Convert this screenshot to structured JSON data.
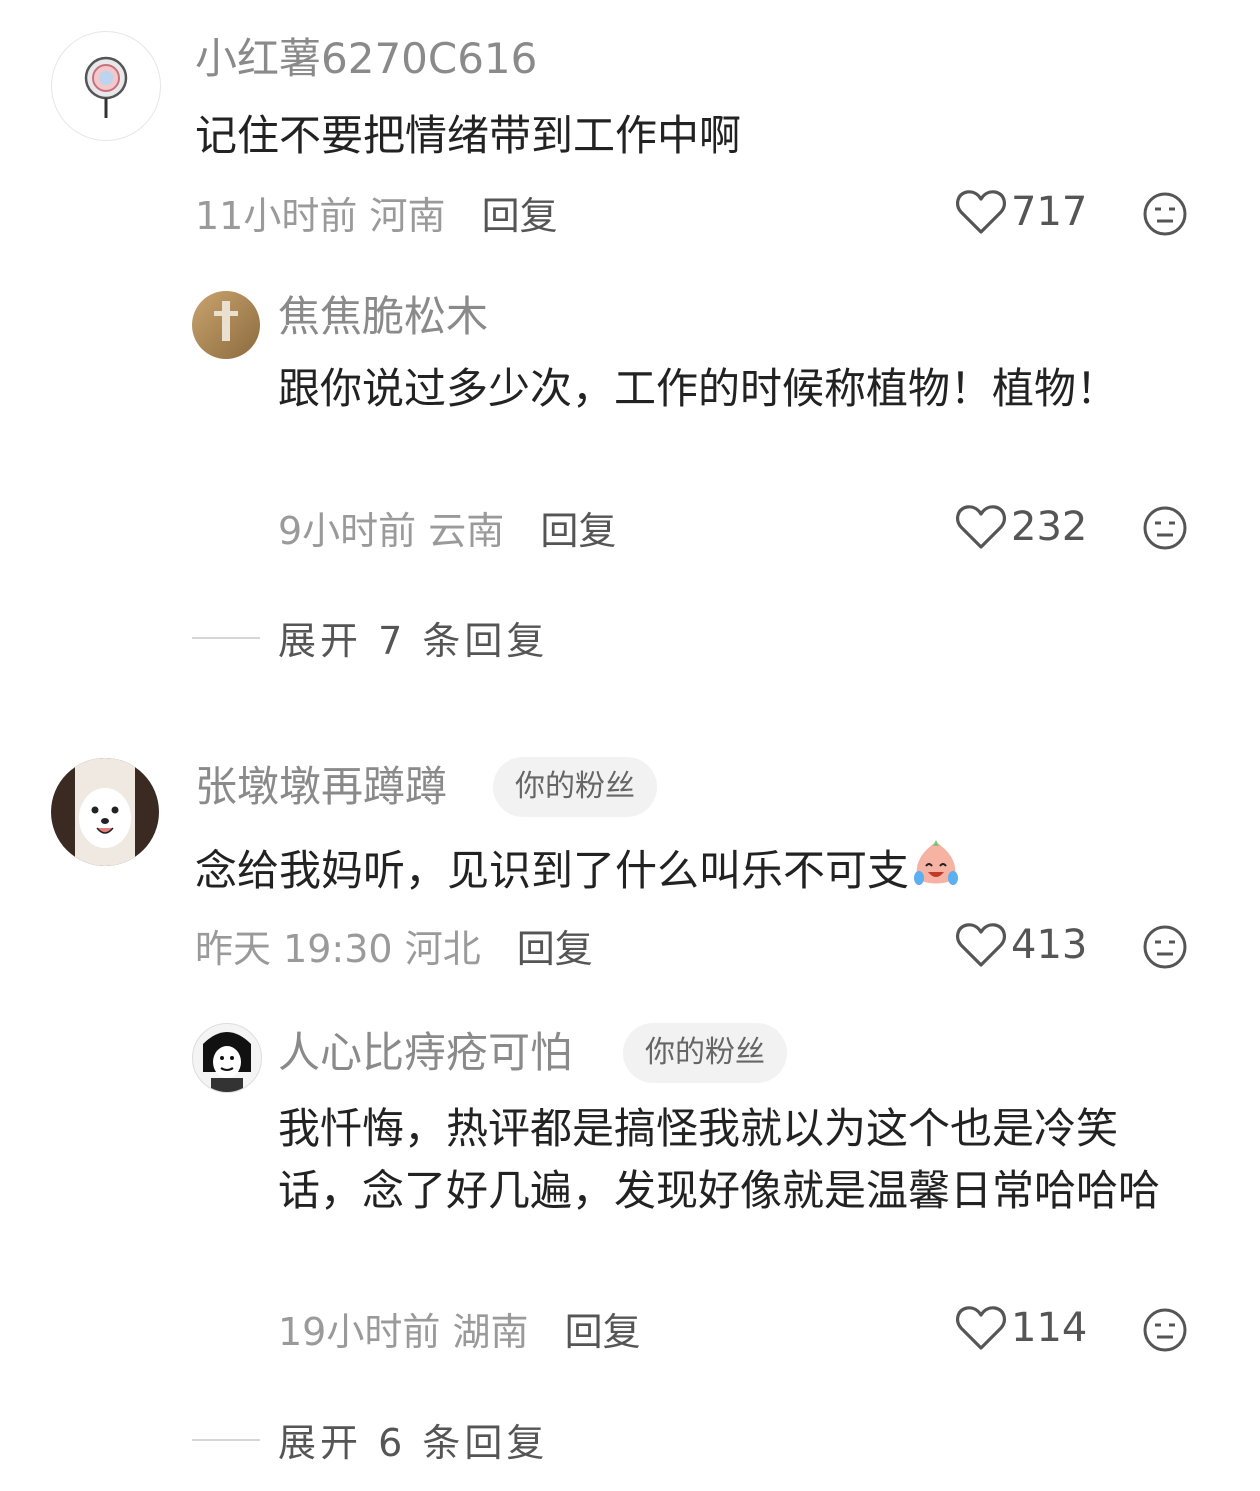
{
  "comments": [
    {
      "user": "小红薯6270C616",
      "text": "记住不要把情绪带到工作中啊",
      "time": "11小时前",
      "location": "河南",
      "reply_label": "回复",
      "likes": "717",
      "replies": [
        {
          "user": "焦焦脆松木",
          "text": "跟你说过多少次，工作的时候称植物！植物！",
          "time": "9小时前",
          "location": "云南",
          "reply_label": "回复",
          "likes": "232"
        }
      ],
      "expand_label": "展开 7 条回复"
    },
    {
      "user": "张墩墩再蹲蹲",
      "badge": "你的粉丝",
      "text": "念给我妈听，见识到了什么叫乐不可支",
      "time": "昨天 19:30",
      "location": "河北",
      "reply_label": "回复",
      "likes": "413",
      "replies": [
        {
          "user": "人心比痔疮可怕",
          "badge": "你的粉丝",
          "text": "我忏悔，热评都是搞怪我就以为这个也是冷笑话，念了好几遍，发现好像就是温馨日常哈哈哈",
          "time": "19小时前",
          "location": "湖南",
          "reply_label": "回复",
          "likes": "114"
        }
      ],
      "expand_label": "展开 6 条回复"
    }
  ],
  "icons": {
    "like": "heart-outline-icon",
    "emoji": "neutral-face-icon",
    "inline_emoji": "laughing-crying-emoji"
  },
  "colors": {
    "name": "#8a8a8a",
    "text": "#222222",
    "meta": "#9a9a9a",
    "badge_bg": "#f2f2f2"
  }
}
